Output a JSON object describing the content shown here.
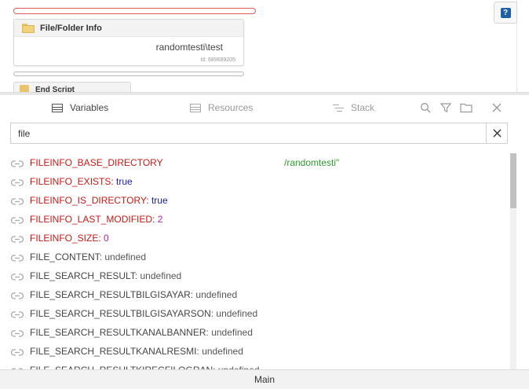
{
  "canvas": {
    "node": {
      "title": "File/Folder Info",
      "value": "randomtesti\\test",
      "id_label": "Id: 689689205"
    },
    "next_node": {
      "title": "End Script"
    }
  },
  "tabs": [
    {
      "label": "Variables",
      "icon": "table-icon",
      "active": true
    },
    {
      "label": "Resources",
      "icon": "table-icon",
      "active": false
    },
    {
      "label": "Stack",
      "icon": "stack-icon",
      "active": false
    }
  ],
  "search": {
    "value": "file"
  },
  "variables": [
    {
      "name": "FILEINFO_BASE_DIRECTORY",
      "separator": "",
      "value": "",
      "overflow": "/randomtesti\"",
      "style": "red",
      "value_style": "green"
    },
    {
      "name": "FILEINFO_EXISTS",
      "separator": ": ",
      "value": "true",
      "overflow": "",
      "style": "red",
      "value_style": "blue"
    },
    {
      "name": "FILEINFO_IS_DIRECTORY",
      "separator": ": ",
      "value": "true",
      "overflow": "",
      "style": "red",
      "value_style": "blue"
    },
    {
      "name": "FILEINFO_LAST_MODIFIED",
      "separator": ": ",
      "value": "2",
      "overflow": "",
      "style": "red",
      "value_style": "purple"
    },
    {
      "name": "FILEINFO_SIZE",
      "separator": ": ",
      "value": "0",
      "overflow": "",
      "style": "red",
      "value_style": "purple"
    },
    {
      "name": "FILE_CONTENT",
      "separator": ": ",
      "value": "undefined",
      "overflow": "",
      "style": "normal",
      "value_style": "grey"
    },
    {
      "name": "FILE_SEARCH_RESULT",
      "separator": ": ",
      "value": "undefined",
      "overflow": "",
      "style": "normal",
      "value_style": "grey"
    },
    {
      "name": "FILE_SEARCH_RESULTBILGISAYAR",
      "separator": ": ",
      "value": "undefined",
      "overflow": "",
      "style": "normal",
      "value_style": "grey"
    },
    {
      "name": "FILE_SEARCH_RESULTBILGISAYARSON",
      "separator": ": ",
      "value": "undefined",
      "overflow": "",
      "style": "normal",
      "value_style": "grey"
    },
    {
      "name": "FILE_SEARCH_RESULTKANALBANNER",
      "separator": ": ",
      "value": "undefined",
      "overflow": "",
      "style": "normal",
      "value_style": "grey"
    },
    {
      "name": "FILE_SEARCH_RESULTKANALRESMI",
      "separator": ": ",
      "value": "undefined",
      "overflow": "",
      "style": "normal",
      "value_style": "grey"
    },
    {
      "name": "FILE_SEARCH_RESULTKIRECFILOGRAN",
      "separator": ": ",
      "value": "undefined",
      "overflow": "",
      "style": "normal",
      "value_style": "grey"
    }
  ],
  "bottom_bar": {
    "label": "Main"
  },
  "colors": {
    "name_red": "#c41a16",
    "value_blue": "#1a1aa6",
    "value_purple": "#aa22aa",
    "value_green": "#2e9a2e",
    "help_blue": "#1f5fa8"
  }
}
